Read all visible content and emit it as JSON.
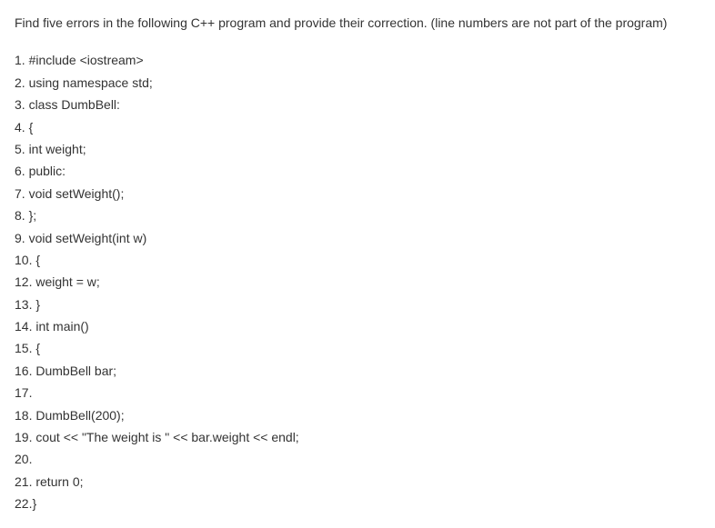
{
  "question": "Find five errors in the following C++ program and provide their correction. (line numbers are not part of the program)",
  "code": {
    "l1": "1. #include <iostream>",
    "l2": "2. using namespace std;",
    "l3": "3. class DumbBell:",
    "l4": "4. {",
    "l5": "5. int weight;",
    "l6": "6. public:",
    "l7": "7. void setWeight();",
    "l8": "8. };",
    "l9": "9. void setWeight(int w)",
    "l10": "10. {",
    "l12": "12.   weight = w;",
    "l13": "13. }",
    "l14": "14. int main()",
    "l15": "15. {",
    "l16": "16.   DumbBell bar;",
    "l17": "17.",
    "l18": "18.   DumbBell(200);",
    "l19": "19.   cout << \"The weight is \" << bar.weight << endl;",
    "l20": "20.",
    "l21": "21.   return 0;",
    "l22": "22.}"
  }
}
